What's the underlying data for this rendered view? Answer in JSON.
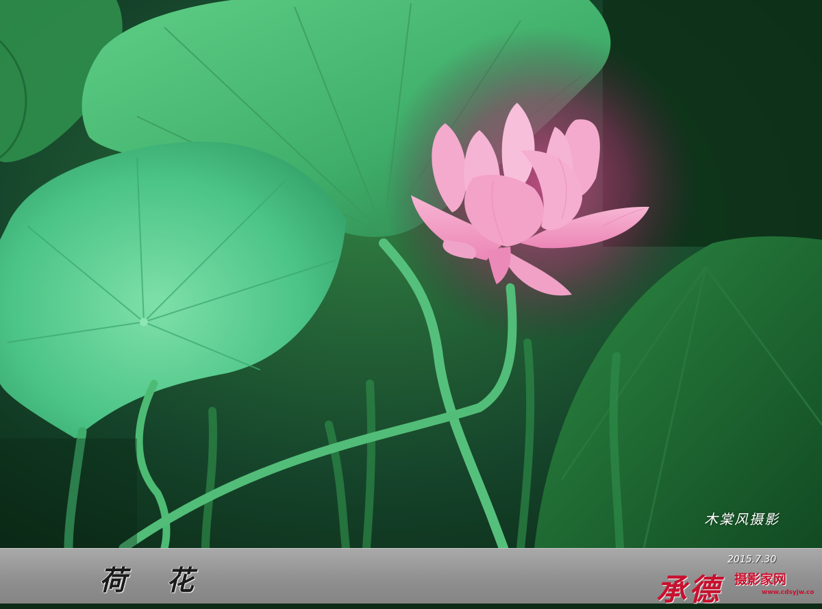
{
  "photo": {
    "subject": "pink lotus flower among green lotus leaves",
    "colors": {
      "petal": "#f4a6c8",
      "leaf_light": "#6fd39a",
      "leaf_dark": "#0f3d1c",
      "glow": "#c2407a"
    }
  },
  "signature": "木棠风摄影",
  "caption": {
    "title": "荷 花",
    "date": "2015.7.30"
  },
  "brand": {
    "cursive": "承德",
    "name": "摄影家网",
    "url": "www.cdsyjw.co",
    "color": "#c8102e"
  }
}
